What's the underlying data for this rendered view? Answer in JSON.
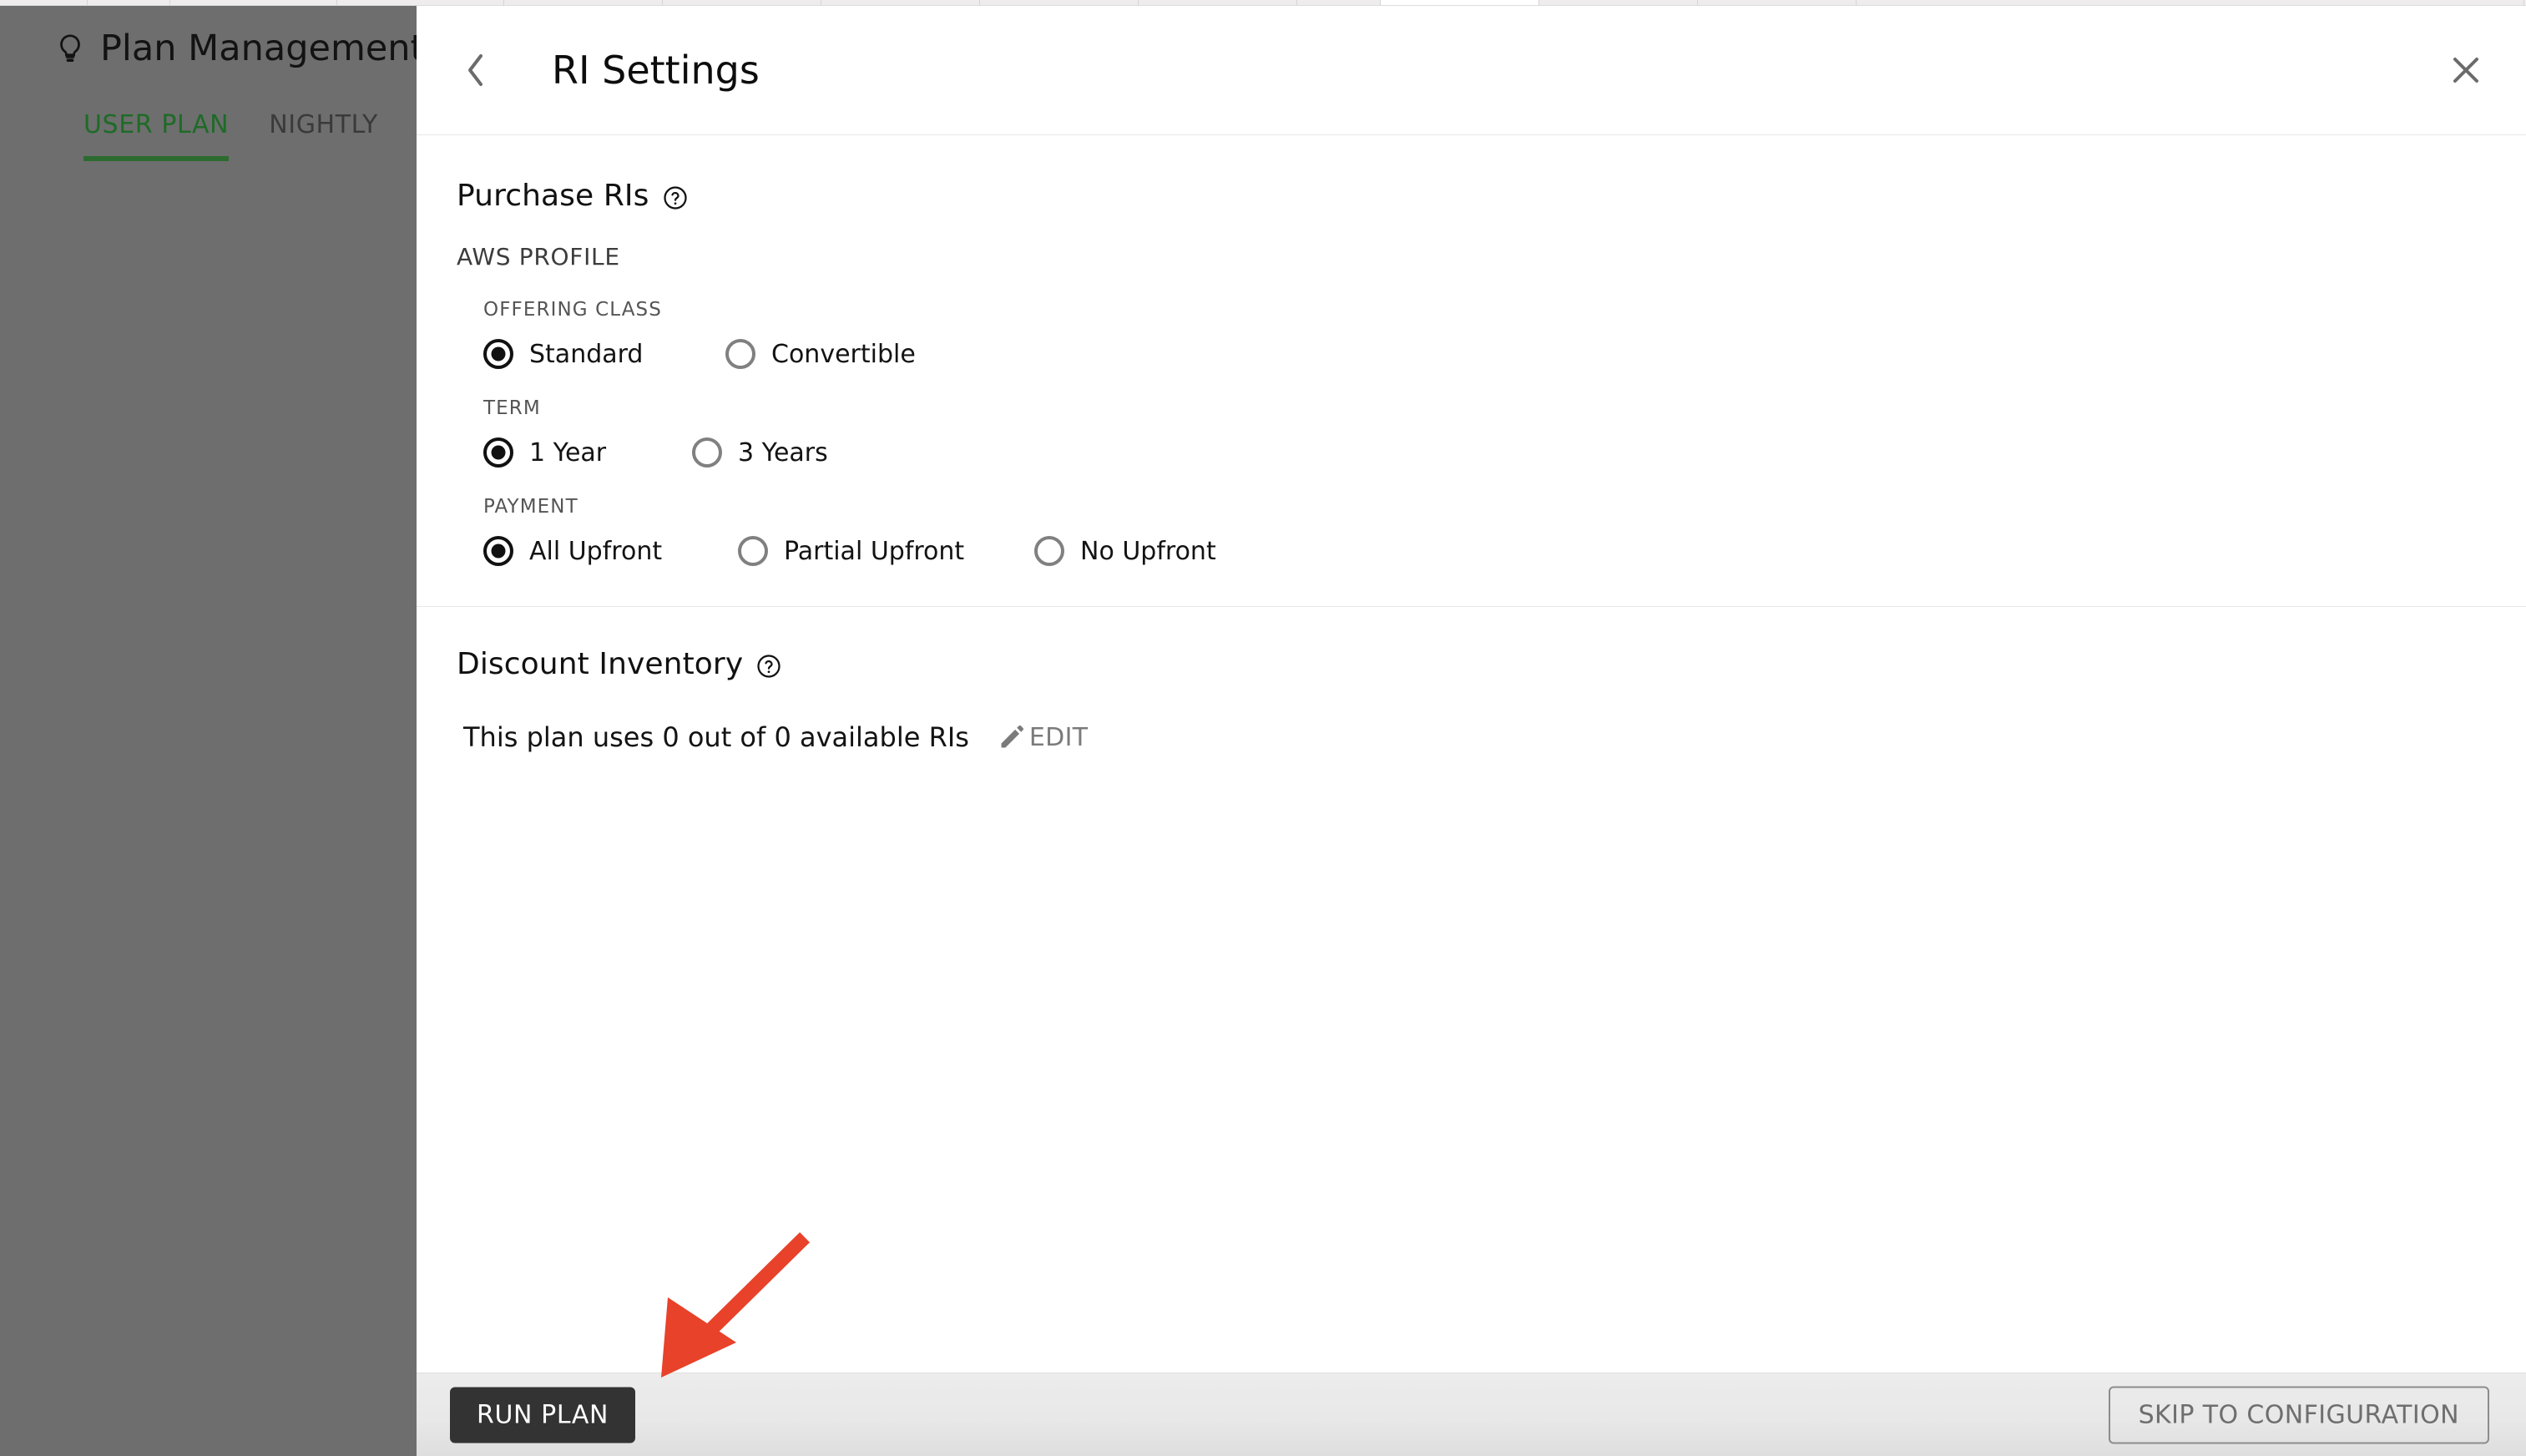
{
  "background_app": {
    "title": "Plan Management",
    "title_icon": "lightbulb-icon",
    "tabs": [
      {
        "label": "USER PLAN",
        "active": true
      },
      {
        "label": "NIGHTLY",
        "active": false
      }
    ]
  },
  "panel": {
    "title": "RI Settings",
    "back_icon": "chevron-left-icon",
    "close_icon": "close-icon",
    "sections": {
      "purchase": {
        "title": "Purchase RIs",
        "help_icon": "help-circle-icon",
        "profile_label": "AWS PROFILE",
        "groups": [
          {
            "label": "OFFERING CLASS",
            "options": [
              {
                "label": "Standard",
                "checked": true
              },
              {
                "label": "Convertible",
                "checked": false
              }
            ]
          },
          {
            "label": "TERM",
            "options": [
              {
                "label": "1 Year",
                "checked": true
              },
              {
                "label": "3 Years",
                "checked": false
              }
            ]
          },
          {
            "label": "PAYMENT",
            "options": [
              {
                "label": "All Upfront",
                "checked": true
              },
              {
                "label": "Partial Upfront",
                "checked": false
              },
              {
                "label": "No Upfront",
                "checked": false
              }
            ]
          }
        ]
      },
      "discount": {
        "title": "Discount Inventory",
        "help_icon": "help-circle-icon",
        "usage_text": "This plan uses 0 out of 0 available RIs",
        "used_count": "0",
        "available_count": "0",
        "edit_label": "EDIT",
        "edit_icon": "pencil-icon"
      }
    },
    "footer": {
      "run_plan_label": "RUN PLAN",
      "skip_label": "SKIP TO CONFIGURATION"
    }
  },
  "annotation": {
    "type": "arrow",
    "color": "#E8422A",
    "points_to": "RUN PLAN"
  },
  "colors": {
    "accent_green": "#2c6b2f",
    "primary_button": "#333333",
    "annotation_red": "#E8422A",
    "overlay_dim": "#6e6e6e"
  }
}
